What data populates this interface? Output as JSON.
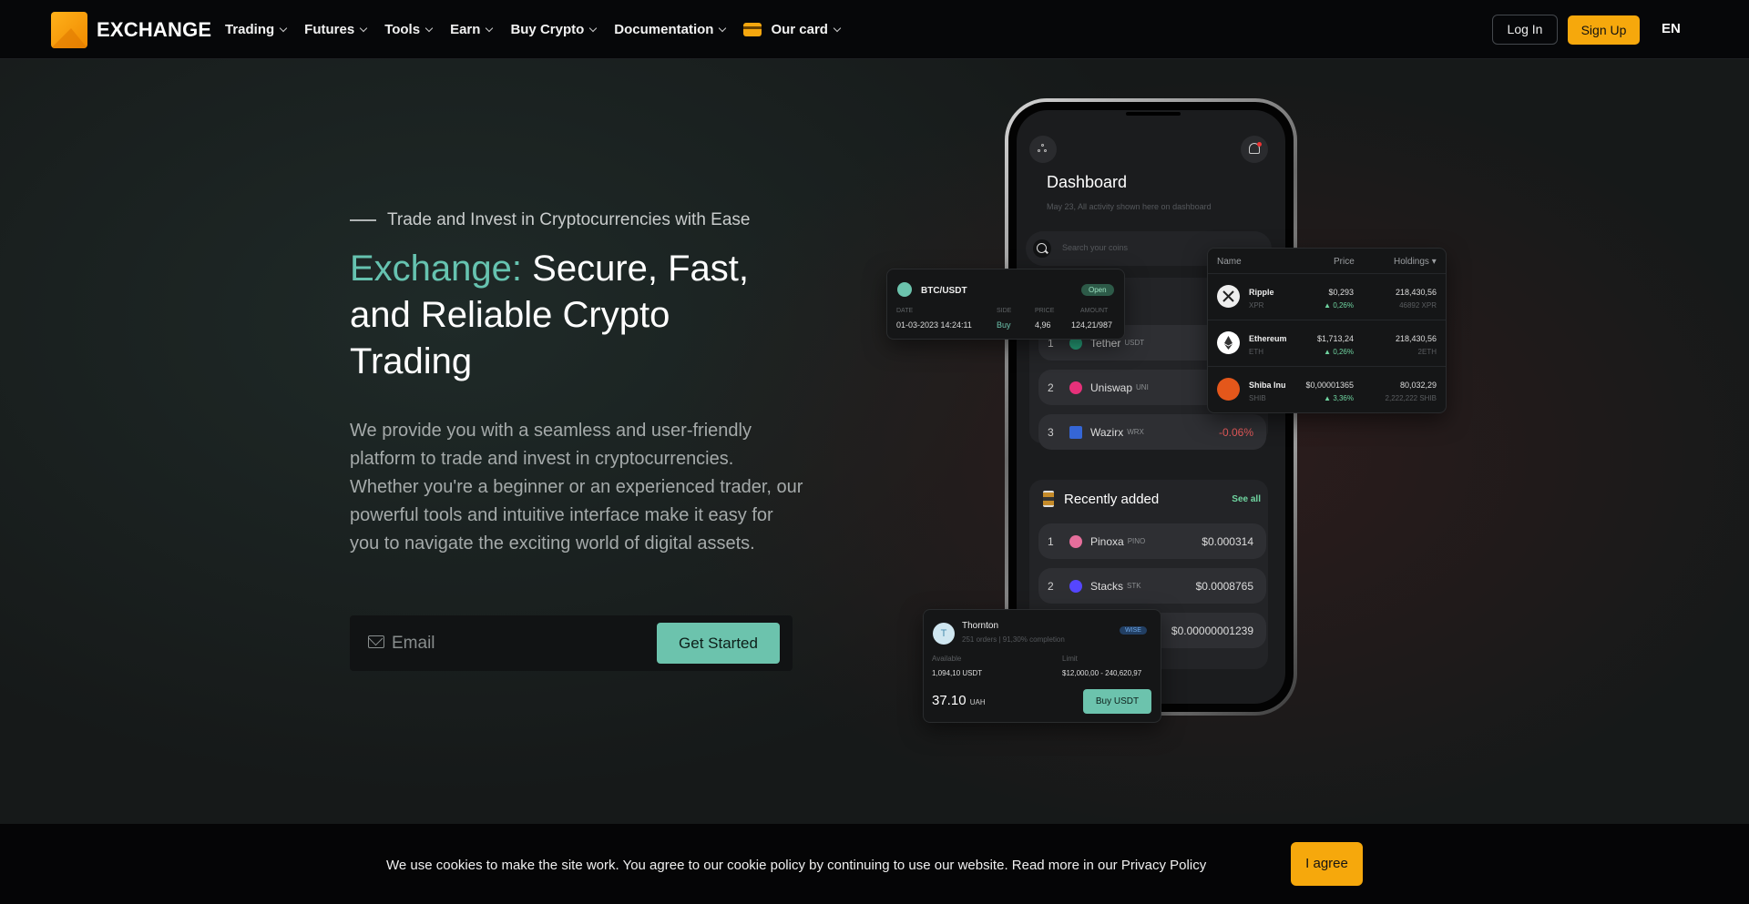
{
  "brand": {
    "name": "EXCHANGE",
    "accent": "#f6a80c"
  },
  "nav": {
    "items": [
      {
        "label": "Trading"
      },
      {
        "label": "Futures"
      },
      {
        "label": "Tools"
      },
      {
        "label": "Earn"
      },
      {
        "label": "Buy Crypto"
      },
      {
        "label": "Documentation"
      },
      {
        "label": "Our card"
      }
    ],
    "login": "Log In",
    "signup": "Sign Up",
    "lang": "EN"
  },
  "hero": {
    "tagline": "Trade and Invest in Cryptocurrencies with Ease",
    "title_accent": "Exchange:",
    "title_rest": "Secure, Fast, and Reliable Crypto Trading",
    "description": "We provide you with a seamless and user-friendly platform to trade and invest in cryptocurrencies. Whether you're a beginner or an experienced trader, our powerful tools and intuitive interface make it easy for you to navigate the exciting world of digital assets.",
    "email_placeholder": "Email",
    "cta": "Get Started",
    "accent_color": "#66c3b0"
  },
  "phone": {
    "title": "Dashboard",
    "subtitle": "May 23, All activity shown here on dashboard",
    "search_placeholder": "Search your coins",
    "top_list": [
      {
        "rank": "1",
        "name": "Tether",
        "ticker": "USDT",
        "value": ""
      },
      {
        "rank": "2",
        "name": "Uniswap",
        "ticker": "UNI",
        "value": ""
      },
      {
        "rank": "3",
        "name": "Wazirx",
        "ticker": "WRX",
        "value": "-0.06%"
      }
    ],
    "recent_title": "Recently added",
    "see_all": "See all",
    "recent": [
      {
        "rank": "1",
        "name": "Pinoxa",
        "ticker": "PINO",
        "value": "$0.000314"
      },
      {
        "rank": "2",
        "name": "Stacks",
        "ticker": "STK",
        "value": "$0.0008765"
      },
      {
        "rank": "",
        "name": "",
        "ticker": "",
        "value": "$0.00000001239"
      }
    ]
  },
  "btc_card": {
    "pair": "BTC/USDT",
    "status": "Open",
    "labels": {
      "date": "DATE",
      "side": "SIDE",
      "price": "PRICE",
      "amount": "AMOUNT"
    },
    "date": "01-03-2023 14:24:11",
    "side": "Buy",
    "price": "4,96",
    "amount": "124,21/987"
  },
  "holdings": {
    "headers": {
      "name": "Name",
      "price": "Price",
      "holdings": "Holdings"
    },
    "rows": [
      {
        "name": "Ripple",
        "ticker": "XPR",
        "price": "$0,293",
        "change": "0,26%",
        "amount": "218,430,56",
        "sub": "46892 XPR"
      },
      {
        "name": "Ethereum",
        "ticker": "ETH",
        "price": "$1,713,24",
        "change": "0,26%",
        "amount": "218,430,56",
        "sub": "2ETH"
      },
      {
        "name": "Shiba Inu",
        "ticker": "SHIB",
        "price": "$0,00001365",
        "change": "3,36%",
        "amount": "80,032,29",
        "sub": "2,222,222 SHIB"
      }
    ]
  },
  "trader_card": {
    "avatar": "T",
    "name": "Thornton",
    "stats": "251 orders | 91,30% completion",
    "badge": "WISE",
    "available_label": "Available",
    "available": "1,094,10 USDT",
    "limit_label": "Limit",
    "limit": "$12,000,00 - 240,620,97",
    "price": "37.10",
    "currency": "UAH",
    "button": "Buy USDT"
  },
  "cookie": {
    "text": "We use cookies to make the site work. You agree to our cookie policy by continuing to use our website. Read more in our Privacy Policy",
    "button": "I agree"
  }
}
